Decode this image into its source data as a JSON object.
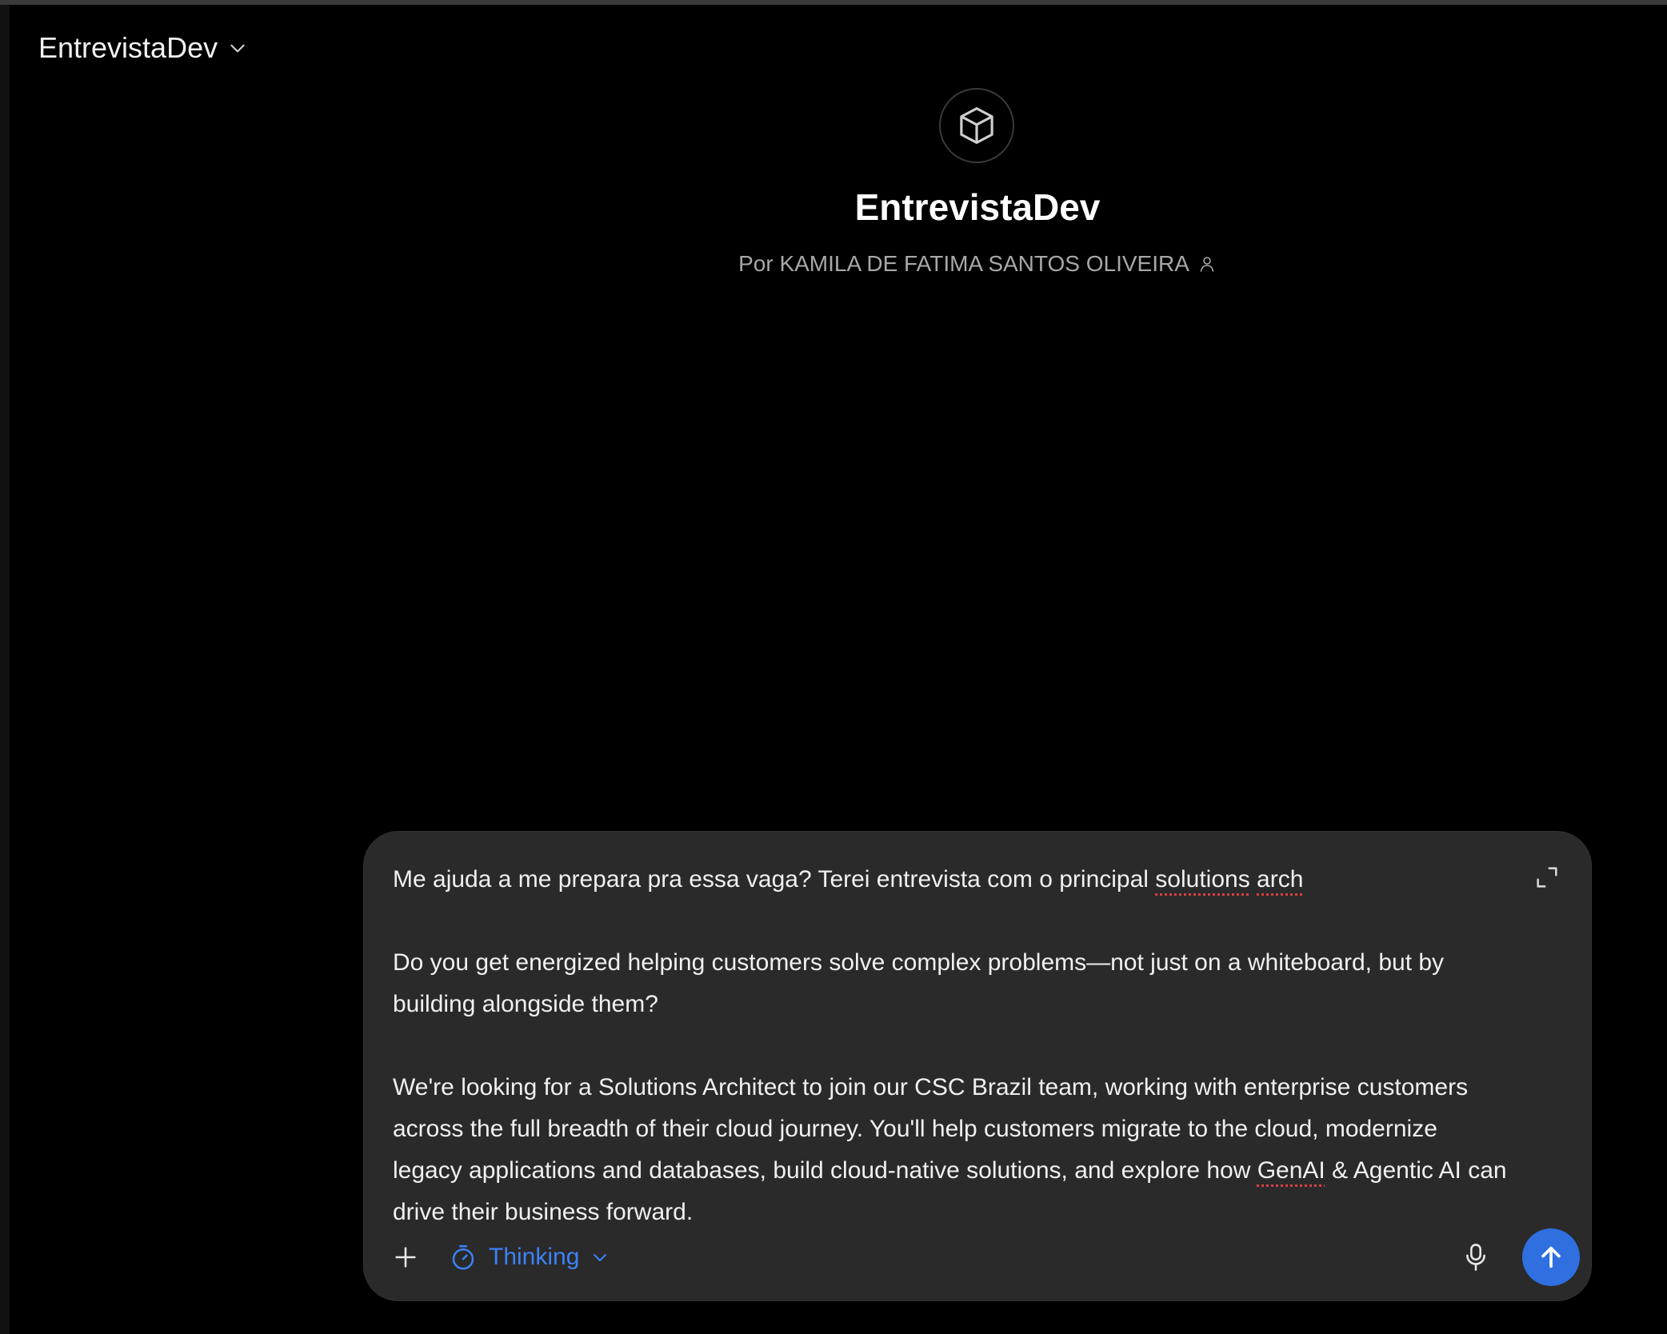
{
  "header": {
    "model_name": "EntrevistaDev"
  },
  "gpt": {
    "title": "EntrevistaDev",
    "author": "Por KAMILA DE FATIMA SANTOS OLIVEIRA"
  },
  "composer": {
    "line1_before": "Me ajuda a me prepara pra essa vaga? Terei entrevista com o principal ",
    "line1_spell1": "solutions",
    "line1_space": " ",
    "line1_spell2": "arch",
    "para2": "Do you get energized helping customers solve complex problems—not just on a whiteboard, but by building alongside them?",
    "para3_before": "We're looking for a Solutions Architect to join our CSC Brazil team, working with enterprise customers across the full breadth of their cloud journey. You'll help customers migrate to the cloud, modernize legacy applications and databases, build cloud-native solutions, and explore how ",
    "para3_spell": "GenAI",
    "para3_after": " & Agentic AI can drive their business forward.",
    "thinking_label": "Thinking"
  },
  "icons": {
    "model_chevron": "chevron-down-icon",
    "avatar": "cube-icon",
    "author": "person-icon",
    "expand": "expand-icon",
    "add": "plus-icon",
    "thinking": "timer-icon",
    "thinking_chevron": "chevron-down-icon",
    "mic": "microphone-icon",
    "send": "arrow-up-icon"
  },
  "colors": {
    "background": "#000000",
    "composer_bg": "#2a2a2a",
    "accent": "#3b82f6",
    "send_button": "#2f6fe0",
    "muted_text": "#a8a8a8"
  }
}
